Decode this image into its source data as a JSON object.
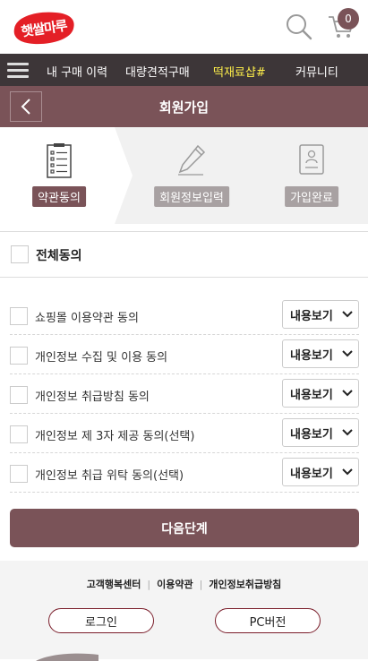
{
  "header": {
    "logo_text": "햇쌀마루",
    "brand_color": "#e41f26",
    "cart_count": "0"
  },
  "nav": {
    "items": [
      "내 구매 이력",
      "대량견적구매",
      "떡재료샵#",
      "커뮤니티"
    ]
  },
  "page": {
    "title": "회원가입"
  },
  "steps": [
    {
      "label": "약관동의",
      "icon": "clipboard-list-icon",
      "active": true
    },
    {
      "label": "회원정보입력",
      "icon": "pencil-icon",
      "active": false
    },
    {
      "label": "가입완료",
      "icon": "id-card-icon",
      "active": false
    }
  ],
  "agree_all": {
    "label": "전체동의"
  },
  "terms": [
    {
      "label": "쇼핑몰 이용약관 동의",
      "button": "내용보기"
    },
    {
      "label": "개인정보 수집 및 이용 동의",
      "button": "내용보기"
    },
    {
      "label": "개인정보 취급방침 동의",
      "button": "내용보기"
    },
    {
      "label": "개인정보 제 3자 제공 동의(선택)",
      "button": "내용보기"
    },
    {
      "label": "개인정보 취급 위탁 동의(선택)",
      "button": "내용보기"
    }
  ],
  "next_button": "다음단계",
  "footer": {
    "links": [
      "고객행복센터",
      "이용약관",
      "개인정보취급방침"
    ],
    "login_button": "로그인",
    "pc_button": "PC버전"
  },
  "colors": {
    "accent": "#7a5358",
    "nav_bg": "#3d3638",
    "nav_highlight": "#fff04a"
  }
}
